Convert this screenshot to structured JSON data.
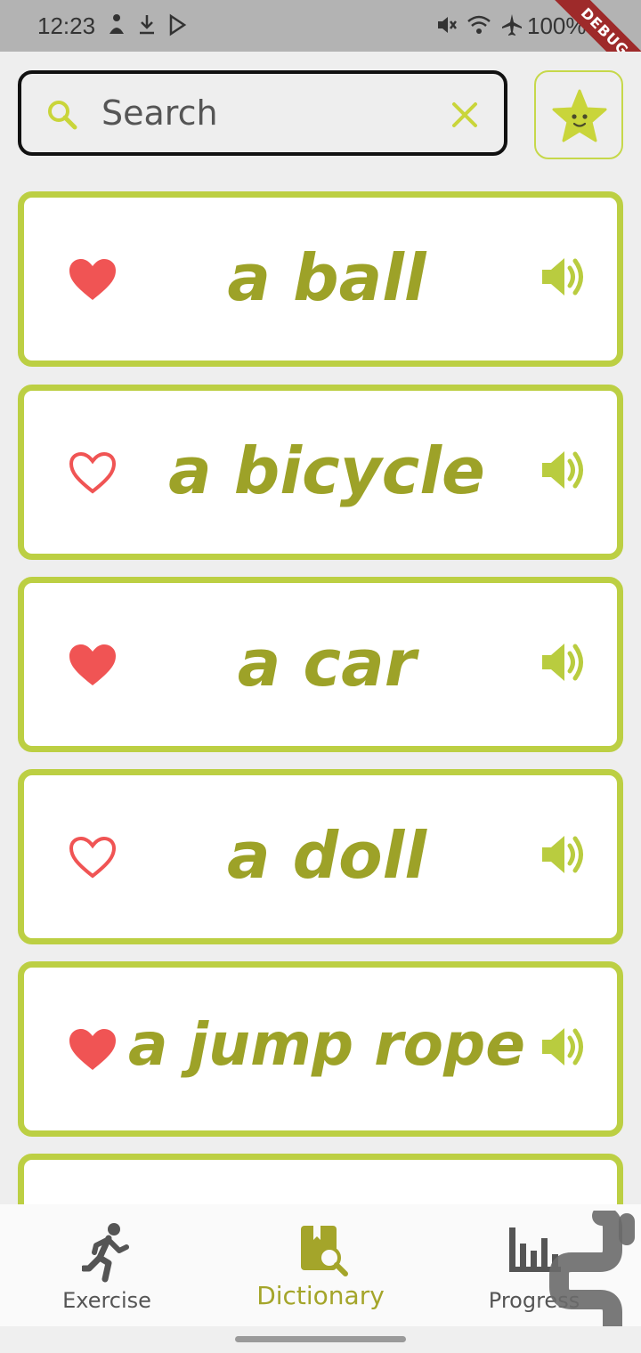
{
  "status_bar": {
    "time": "12:23",
    "battery": "100%",
    "debug_label": "DEBUG",
    "left_icons": [
      "person-icon",
      "download-icon",
      "play-store-icon"
    ],
    "right_icons": [
      "mute-icon",
      "wifi-icon",
      "airplane-icon",
      "battery-icon"
    ]
  },
  "search": {
    "placeholder": "Search",
    "value": ""
  },
  "favorites_button": {
    "icon": "star-face-icon"
  },
  "words": [
    {
      "text": "a ball",
      "favorite": true
    },
    {
      "text": "a bicycle",
      "favorite": false
    },
    {
      "text": "a car",
      "favorite": true
    },
    {
      "text": "a doll",
      "favorite": false
    },
    {
      "text": "a jump rope",
      "favorite": true
    }
  ],
  "bottom_nav": {
    "items": [
      {
        "label": "Exercise",
        "icon": "running-person-icon",
        "active": false
      },
      {
        "label": "Dictionary",
        "icon": "dictionary-search-icon",
        "active": true
      },
      {
        "label": "Progress",
        "icon": "bar-chart-icon",
        "active": false
      }
    ]
  },
  "colors": {
    "accent": "#bccf43",
    "word_text": "#9da228",
    "heart": "#f05454",
    "status_bar": "#b3b3b3",
    "background": "#eeeeee"
  }
}
